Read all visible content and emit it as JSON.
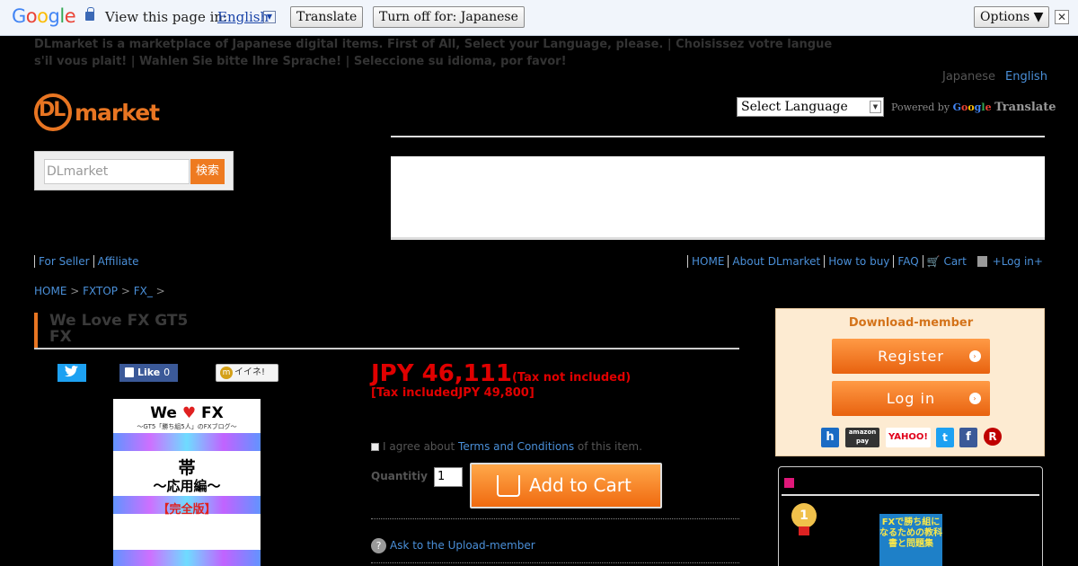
{
  "gtranslate": {
    "view_label": "View this page in:",
    "language": "English",
    "translate_btn": "Translate",
    "turnoff_btn": "Turn off for: Japanese",
    "options_btn": "Options ▼",
    "close": "✕"
  },
  "notice": "DLmarket is a marketplace of Japanese digital items. First of All, Select your Language, please. | Choisissez votre langue s'il vous plait! | Wahlen Sie bitte Ihre Sprache! | Seleccione su idioma, por favor!",
  "lang_links": {
    "japanese": "Japanese",
    "english": "English"
  },
  "logo": {
    "dl": "DL",
    "market": "market"
  },
  "select_language": "Select Language",
  "powered_by": "Powered by",
  "translate_word": "Translate",
  "search": {
    "placeholder": "DLmarket",
    "button": "検索"
  },
  "subnav_left": [
    "For Seller",
    "Affiliate"
  ],
  "subnav_right": {
    "home": "HOME",
    "about": "About DLmarket",
    "howto": "How to buy",
    "faq": "FAQ",
    "cart": "Cart",
    "login": "+Log in+"
  },
  "breadcrumb": [
    "HOME",
    "FXTOP",
    "FX_"
  ],
  "product": {
    "title_line1": "We Love FX GT5",
    "title_line2": "FX",
    "price_main": "JPY 46,111",
    "price_note": "(Tax not included)",
    "price_incl": "[Tax includedJPY 49,800]",
    "agree_prefix": "I agree about",
    "agree_link": "Terms and Conditions",
    "agree_suffix": "of this item.",
    "qty_label": "Quantitiy",
    "qty_value": "1",
    "cart_button": "Add to Cart",
    "ask_link": "Ask to the Upload-member"
  },
  "share": {
    "like": "Like",
    "like_count": "0",
    "mixi": "イイネ!"
  },
  "cover": {
    "line1_a": "We",
    "line1_heart": "♥",
    "line1_b": "FX",
    "line2": "〜GT5「勝ち組5人」のFXブログ〜",
    "line3": "帯",
    "line4": "〜応用編〜",
    "line5": "【完全版】"
  },
  "member": {
    "heading": "Download-member",
    "register": "Register",
    "login": "Log in"
  },
  "social_logins": [
    "h",
    "amazon pay",
    "YAHOO!",
    "t",
    "f",
    "R"
  ],
  "ranking": {
    "medal": "1",
    "book_text": "FXで勝ち組になるための教科書と問題集"
  },
  "colors": {
    "accent": "#e87522",
    "price": "#e00000",
    "link": "#4a8fd8"
  }
}
